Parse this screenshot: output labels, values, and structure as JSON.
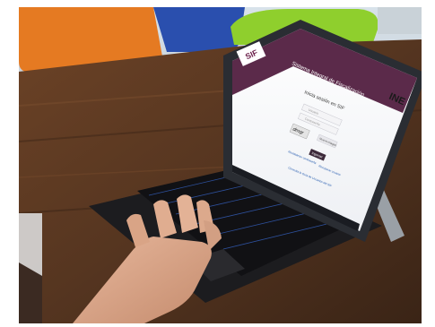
{
  "screen": {
    "portal_title": "Sistema Integral de Fiscalización",
    "brand_logo_text": "SIF",
    "authority_logo_text": "INE",
    "login_heading": "Inicia sesión en SIF",
    "username_placeholder": "Usuario",
    "password_placeholder": "Contraseña",
    "captcha_text": "dmqr",
    "captcha_refresh_label": "Nueva imagen",
    "login_button_label": "Ingresar",
    "link_left": "Restablecer contraseña",
    "link_right": "Recuperar usuario",
    "footer_link": "Consulta la Guía de Usuarios del SIF"
  },
  "colors": {
    "wood": "#5a3a24",
    "header_bar": "#5b2a4a",
    "login_button": "#3d2a3a",
    "chair_orange": "#e57a22",
    "chair_green": "#8fcf2d",
    "chair_blue": "#2a4fae"
  }
}
